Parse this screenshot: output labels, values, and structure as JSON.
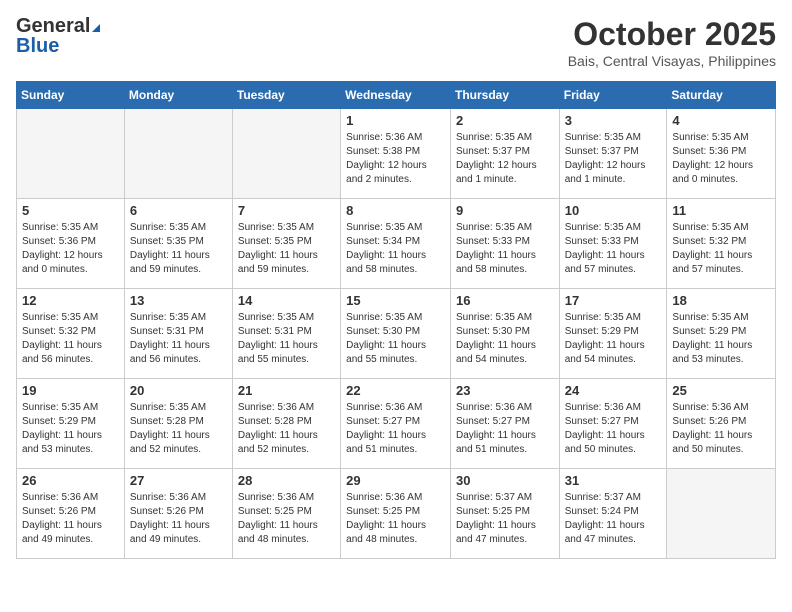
{
  "logo": {
    "general": "General",
    "blue": "Blue"
  },
  "title": "October 2025",
  "location": "Bais, Central Visayas, Philippines",
  "days_header": [
    "Sunday",
    "Monday",
    "Tuesday",
    "Wednesday",
    "Thursday",
    "Friday",
    "Saturday"
  ],
  "weeks": [
    [
      {
        "day": "",
        "sunrise": "",
        "sunset": "",
        "daylight": "",
        "empty": true
      },
      {
        "day": "",
        "sunrise": "",
        "sunset": "",
        "daylight": "",
        "empty": true
      },
      {
        "day": "",
        "sunrise": "",
        "sunset": "",
        "daylight": "",
        "empty": true
      },
      {
        "day": "1",
        "sunrise": "Sunrise: 5:36 AM",
        "sunset": "Sunset: 5:38 PM",
        "daylight": "Daylight: 12 hours and 2 minutes."
      },
      {
        "day": "2",
        "sunrise": "Sunrise: 5:35 AM",
        "sunset": "Sunset: 5:37 PM",
        "daylight": "Daylight: 12 hours and 1 minute."
      },
      {
        "day": "3",
        "sunrise": "Sunrise: 5:35 AM",
        "sunset": "Sunset: 5:37 PM",
        "daylight": "Daylight: 12 hours and 1 minute."
      },
      {
        "day": "4",
        "sunrise": "Sunrise: 5:35 AM",
        "sunset": "Sunset: 5:36 PM",
        "daylight": "Daylight: 12 hours and 0 minutes."
      }
    ],
    [
      {
        "day": "5",
        "sunrise": "Sunrise: 5:35 AM",
        "sunset": "Sunset: 5:36 PM",
        "daylight": "Daylight: 12 hours and 0 minutes."
      },
      {
        "day": "6",
        "sunrise": "Sunrise: 5:35 AM",
        "sunset": "Sunset: 5:35 PM",
        "daylight": "Daylight: 11 hours and 59 minutes."
      },
      {
        "day": "7",
        "sunrise": "Sunrise: 5:35 AM",
        "sunset": "Sunset: 5:35 PM",
        "daylight": "Daylight: 11 hours and 59 minutes."
      },
      {
        "day": "8",
        "sunrise": "Sunrise: 5:35 AM",
        "sunset": "Sunset: 5:34 PM",
        "daylight": "Daylight: 11 hours and 58 minutes."
      },
      {
        "day": "9",
        "sunrise": "Sunrise: 5:35 AM",
        "sunset": "Sunset: 5:33 PM",
        "daylight": "Daylight: 11 hours and 58 minutes."
      },
      {
        "day": "10",
        "sunrise": "Sunrise: 5:35 AM",
        "sunset": "Sunset: 5:33 PM",
        "daylight": "Daylight: 11 hours and 57 minutes."
      },
      {
        "day": "11",
        "sunrise": "Sunrise: 5:35 AM",
        "sunset": "Sunset: 5:32 PM",
        "daylight": "Daylight: 11 hours and 57 minutes."
      }
    ],
    [
      {
        "day": "12",
        "sunrise": "Sunrise: 5:35 AM",
        "sunset": "Sunset: 5:32 PM",
        "daylight": "Daylight: 11 hours and 56 minutes."
      },
      {
        "day": "13",
        "sunrise": "Sunrise: 5:35 AM",
        "sunset": "Sunset: 5:31 PM",
        "daylight": "Daylight: 11 hours and 56 minutes."
      },
      {
        "day": "14",
        "sunrise": "Sunrise: 5:35 AM",
        "sunset": "Sunset: 5:31 PM",
        "daylight": "Daylight: 11 hours and 55 minutes."
      },
      {
        "day": "15",
        "sunrise": "Sunrise: 5:35 AM",
        "sunset": "Sunset: 5:30 PM",
        "daylight": "Daylight: 11 hours and 55 minutes."
      },
      {
        "day": "16",
        "sunrise": "Sunrise: 5:35 AM",
        "sunset": "Sunset: 5:30 PM",
        "daylight": "Daylight: 11 hours and 54 minutes."
      },
      {
        "day": "17",
        "sunrise": "Sunrise: 5:35 AM",
        "sunset": "Sunset: 5:29 PM",
        "daylight": "Daylight: 11 hours and 54 minutes."
      },
      {
        "day": "18",
        "sunrise": "Sunrise: 5:35 AM",
        "sunset": "Sunset: 5:29 PM",
        "daylight": "Daylight: 11 hours and 53 minutes."
      }
    ],
    [
      {
        "day": "19",
        "sunrise": "Sunrise: 5:35 AM",
        "sunset": "Sunset: 5:29 PM",
        "daylight": "Daylight: 11 hours and 53 minutes."
      },
      {
        "day": "20",
        "sunrise": "Sunrise: 5:35 AM",
        "sunset": "Sunset: 5:28 PM",
        "daylight": "Daylight: 11 hours and 52 minutes."
      },
      {
        "day": "21",
        "sunrise": "Sunrise: 5:36 AM",
        "sunset": "Sunset: 5:28 PM",
        "daylight": "Daylight: 11 hours and 52 minutes."
      },
      {
        "day": "22",
        "sunrise": "Sunrise: 5:36 AM",
        "sunset": "Sunset: 5:27 PM",
        "daylight": "Daylight: 11 hours and 51 minutes."
      },
      {
        "day": "23",
        "sunrise": "Sunrise: 5:36 AM",
        "sunset": "Sunset: 5:27 PM",
        "daylight": "Daylight: 11 hours and 51 minutes."
      },
      {
        "day": "24",
        "sunrise": "Sunrise: 5:36 AM",
        "sunset": "Sunset: 5:27 PM",
        "daylight": "Daylight: 11 hours and 50 minutes."
      },
      {
        "day": "25",
        "sunrise": "Sunrise: 5:36 AM",
        "sunset": "Sunset: 5:26 PM",
        "daylight": "Daylight: 11 hours and 50 minutes."
      }
    ],
    [
      {
        "day": "26",
        "sunrise": "Sunrise: 5:36 AM",
        "sunset": "Sunset: 5:26 PM",
        "daylight": "Daylight: 11 hours and 49 minutes."
      },
      {
        "day": "27",
        "sunrise": "Sunrise: 5:36 AM",
        "sunset": "Sunset: 5:26 PM",
        "daylight": "Daylight: 11 hours and 49 minutes."
      },
      {
        "day": "28",
        "sunrise": "Sunrise: 5:36 AM",
        "sunset": "Sunset: 5:25 PM",
        "daylight": "Daylight: 11 hours and 48 minutes."
      },
      {
        "day": "29",
        "sunrise": "Sunrise: 5:36 AM",
        "sunset": "Sunset: 5:25 PM",
        "daylight": "Daylight: 11 hours and 48 minutes."
      },
      {
        "day": "30",
        "sunrise": "Sunrise: 5:37 AM",
        "sunset": "Sunset: 5:25 PM",
        "daylight": "Daylight: 11 hours and 47 minutes."
      },
      {
        "day": "31",
        "sunrise": "Sunrise: 5:37 AM",
        "sunset": "Sunset: 5:24 PM",
        "daylight": "Daylight: 11 hours and 47 minutes."
      },
      {
        "day": "",
        "sunrise": "",
        "sunset": "",
        "daylight": "",
        "empty": true
      }
    ]
  ]
}
